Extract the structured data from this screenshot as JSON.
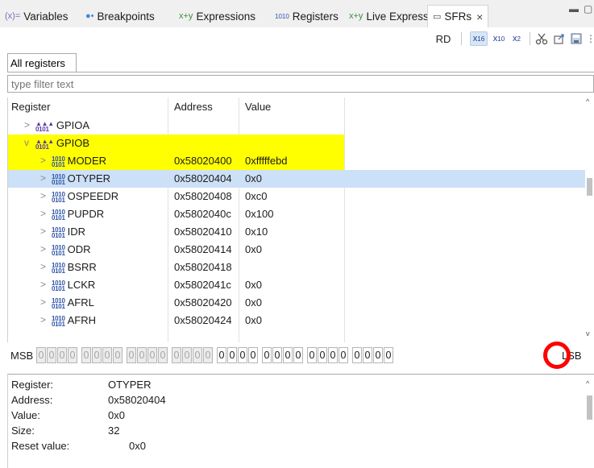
{
  "tabs": [
    {
      "icon": "(x)=",
      "label": "Variables"
    },
    {
      "icon": "●•",
      "label": "Breakpoints"
    },
    {
      "icon": "x+y",
      "label": "Expressions"
    },
    {
      "icon": "1010",
      "label": "Registers"
    },
    {
      "icon": "x+y",
      "label": "Live Expressions"
    },
    {
      "icon": "▭",
      "label": "SFRs",
      "close": "×"
    }
  ],
  "toolbar": {
    "read_label": "RD",
    "radix_hex": "x",
    "radix_hex_sub": "16",
    "radix_dec": "x",
    "radix_dec_sub": "10",
    "radix_bin": "x",
    "radix_bin_sub": "2"
  },
  "inner_tab": "All registers",
  "filter": {
    "placeholder": "type filter text",
    "value": ""
  },
  "columns": {
    "register": "Register",
    "address": "Address",
    "value": "Value"
  },
  "rows": [
    {
      "expander": ">",
      "name": "GPIOA",
      "address": "",
      "value": "",
      "kind": "peripheral",
      "state": "normal"
    },
    {
      "expander": "v",
      "name": "GPIOB",
      "address": "",
      "value": "",
      "kind": "peripheral",
      "state": "yellow"
    },
    {
      "expander": ">",
      "name": "MODER",
      "address": "0x58020400",
      "value": "0xfffffebd",
      "kind": "register",
      "state": "yellow"
    },
    {
      "expander": ">",
      "name": "OTYPER",
      "address": "0x58020404",
      "value": "0x0",
      "kind": "register",
      "state": "selected"
    },
    {
      "expander": ">",
      "name": "OSPEEDR",
      "address": "0x58020408",
      "value": "0xc0",
      "kind": "register",
      "state": "normal"
    },
    {
      "expander": ">",
      "name": "PUPDR",
      "address": "0x5802040c",
      "value": "0x100",
      "kind": "register",
      "state": "normal"
    },
    {
      "expander": ">",
      "name": "IDR",
      "address": "0x58020410",
      "value": "0x10",
      "kind": "register",
      "state": "normal"
    },
    {
      "expander": ">",
      "name": "ODR",
      "address": "0x58020414",
      "value": "0x0",
      "kind": "register",
      "state": "normal"
    },
    {
      "expander": ">",
      "name": "BSRR",
      "address": "0x58020418",
      "value": "",
      "kind": "register",
      "state": "normal"
    },
    {
      "expander": ">",
      "name": "LCKR",
      "address": "0x5802041c",
      "value": "0x0",
      "kind": "register",
      "state": "normal"
    },
    {
      "expander": ">",
      "name": "AFRL",
      "address": "0x58020420",
      "value": "0x0",
      "kind": "register",
      "state": "normal"
    },
    {
      "expander": ">",
      "name": "AFRH",
      "address": "0x58020424",
      "value": "0x0",
      "kind": "register",
      "state": "normal"
    }
  ],
  "bits": {
    "msb_label": "MSB",
    "lsb_label": "LSB",
    "values": [
      "0",
      "0",
      "0",
      "0",
      "0",
      "0",
      "0",
      "0",
      "0",
      "0",
      "0",
      "0",
      "0",
      "0",
      "0",
      "0",
      "0",
      "0",
      "0",
      "0",
      "0",
      "0",
      "0",
      "0",
      "0",
      "0",
      "0",
      "0",
      "0",
      "0",
      "0",
      "0"
    ],
    "read_only_count": 16
  },
  "details": [
    {
      "key": "Register:",
      "value": "OTYPER"
    },
    {
      "key": "Address:",
      "value": "0x58020404"
    },
    {
      "key": "Value:",
      "value": "0x0"
    },
    {
      "key": "Size:",
      "value": "32"
    },
    {
      "key": "Reset value:",
      "value": "0x0"
    }
  ],
  "colors": {
    "highlight_yellow": "#ffff00",
    "selection_blue": "#cce0f7",
    "annotation_red": "#ff0000"
  }
}
